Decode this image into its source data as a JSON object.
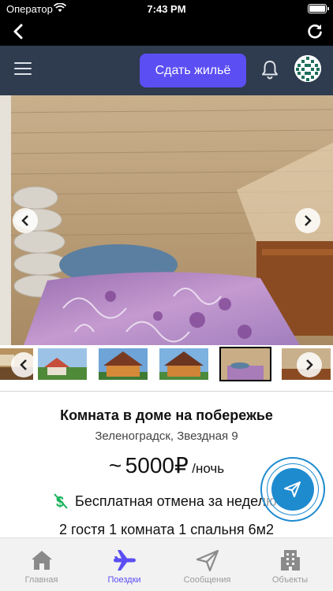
{
  "status_bar": {
    "carrier": "Оператор",
    "time": "7:43 PM"
  },
  "header": {
    "rent_button_label": "Сдать жильё"
  },
  "listing": {
    "title": "Комната в доме на побережье",
    "address": "Зеленоградск, Звездная 9",
    "price_prefix": "~",
    "price": "5000₽",
    "price_unit": "/ночь",
    "cancellation": "Бесплатная отмена за неделю",
    "features": "2 гостя 1 комната 1 спальня 6м2"
  },
  "gallery": {
    "active_index": 3,
    "thumbnail_count": 6
  },
  "tab_bar": {
    "items": [
      {
        "label": "Главная",
        "icon": "home-icon",
        "active": false
      },
      {
        "label": "Поездки",
        "icon": "airplane-icon",
        "active": true
      },
      {
        "label": "Сообщения",
        "icon": "send-icon",
        "active": false
      },
      {
        "label": "Объекты",
        "icon": "building-icon",
        "active": false
      }
    ]
  },
  "colors": {
    "accent": "#5b4ef3",
    "header_bg": "#2f3b4e",
    "fab": "#1e8bcf",
    "cancel_icon": "#19b35c"
  }
}
